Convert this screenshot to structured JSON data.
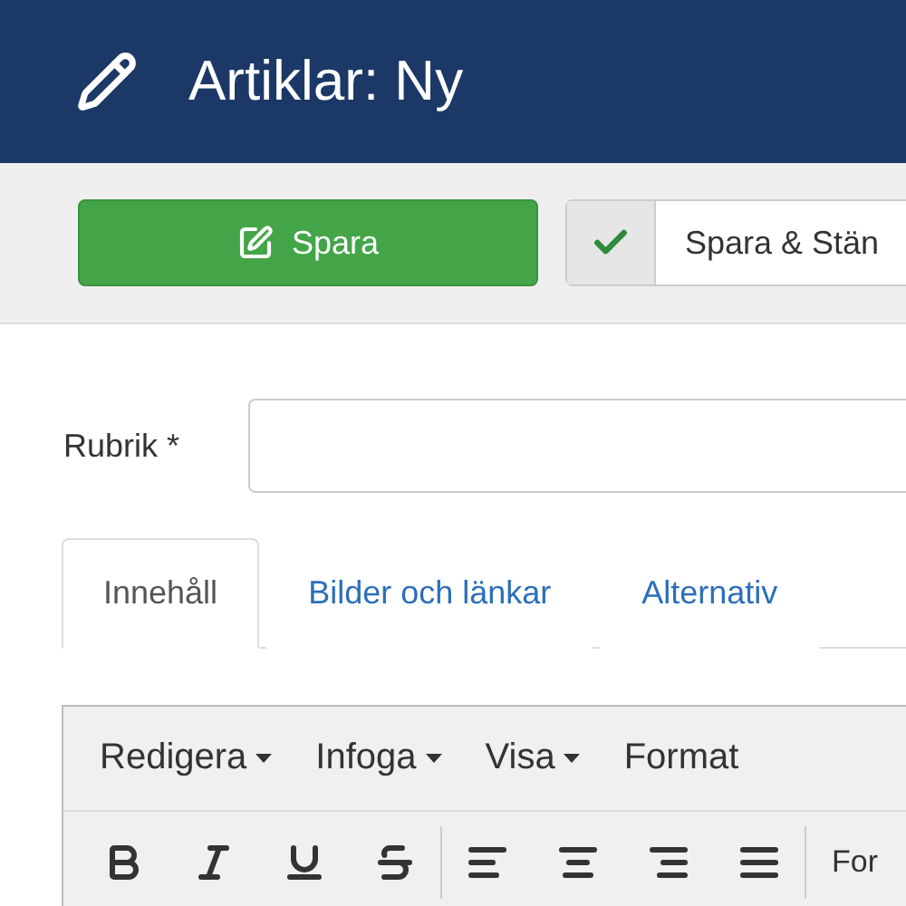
{
  "header": {
    "title": "Artiklar: Ny"
  },
  "toolbar": {
    "buttons": [
      {
        "label": "Spara",
        "kind": "primary"
      },
      {
        "label": "Spara & Stän",
        "kind": "check"
      }
    ]
  },
  "form": {
    "title_label": "Rubrik *"
  },
  "tabs": [
    {
      "label": "Innehåll",
      "selected": true
    },
    {
      "label": "Bilder och länkar",
      "selected": false
    },
    {
      "label": "Alternativ",
      "selected": false
    }
  ],
  "editor": {
    "menus": [
      {
        "label": "Redigera",
        "dropdown": true
      },
      {
        "label": "Infoga",
        "dropdown": true
      },
      {
        "label": "Visa",
        "dropdown": true
      },
      {
        "label": "Format",
        "dropdown": false
      }
    ],
    "tools": [
      {
        "kind": "bold"
      },
      {
        "kind": "italic"
      },
      {
        "kind": "underline"
      },
      {
        "kind": "strike"
      },
      {
        "kind": "sep"
      },
      {
        "kind": "align-left"
      },
      {
        "kind": "align-center"
      },
      {
        "kind": "align-right"
      },
      {
        "kind": "justify"
      },
      {
        "kind": "sep"
      }
    ],
    "format_select": "For"
  }
}
